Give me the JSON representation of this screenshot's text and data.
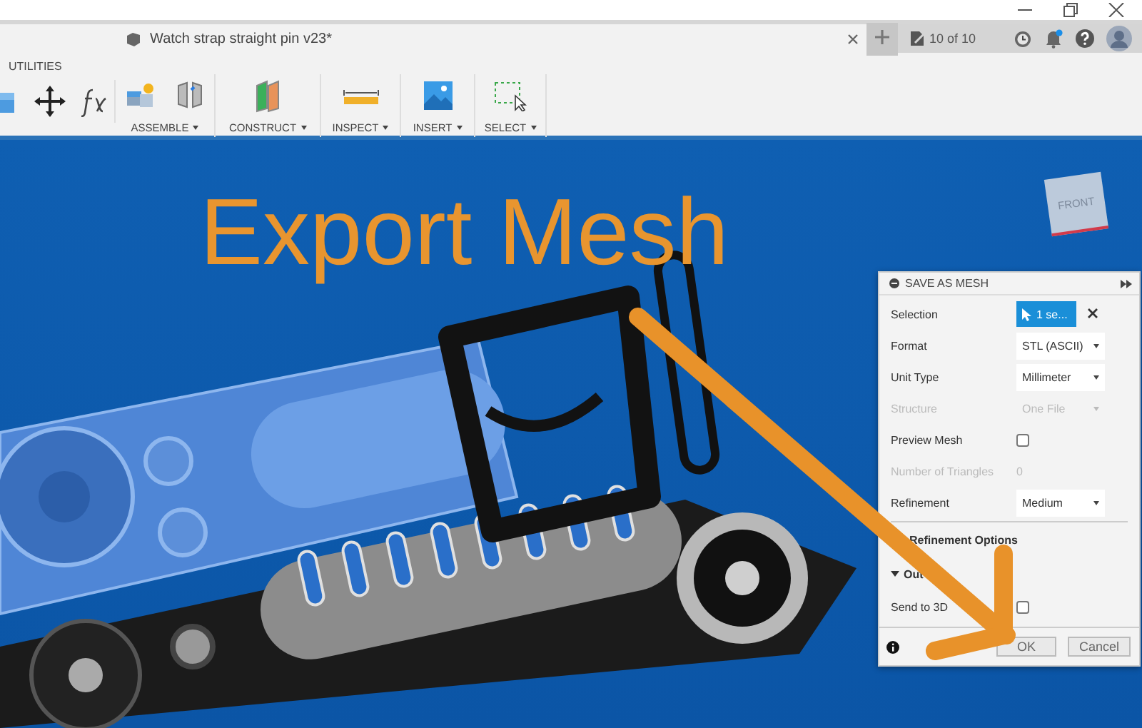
{
  "document_tab": {
    "title": "Watch strap straight pin v23*"
  },
  "tab_bar": {
    "counter": "10 of 10"
  },
  "toolbar": {
    "active_tab": "UTILITIES",
    "groups": [
      {
        "label": "ASSEMBLE"
      },
      {
        "label": "CONSTRUCT"
      },
      {
        "label": "INSPECT"
      },
      {
        "label": "INSERT"
      },
      {
        "label": "SELECT"
      }
    ]
  },
  "viewport": {
    "overlay_title": "Export Mesh",
    "view_cube": {
      "label": "FRONT"
    }
  },
  "dialog": {
    "title": "SAVE AS MESH",
    "rows": [
      {
        "kind": "selection",
        "label": "Selection",
        "value": "1 se..."
      },
      {
        "kind": "dropdown",
        "label": "Format",
        "value": "STL (ASCII)",
        "disabled": false
      },
      {
        "kind": "dropdown",
        "label": "Unit Type",
        "value": "Millimeter",
        "disabled": false
      },
      {
        "kind": "dropdown",
        "label": "Structure",
        "value": "One File",
        "disabled": true
      },
      {
        "kind": "checkbox",
        "label": "Preview Mesh",
        "checked": false,
        "disabled": false
      },
      {
        "kind": "readout",
        "label": "Number of Triangles",
        "value": "0",
        "disabled": true
      },
      {
        "kind": "dropdown",
        "label": "Refinement",
        "value": "Medium",
        "disabled": false
      },
      {
        "kind": "section",
        "label": "Refinement Options"
      },
      {
        "kind": "section",
        "label": "Out",
        "expanded": true
      },
      {
        "kind": "checkbox",
        "label": "Send to 3D",
        "checked": false,
        "disabled": false
      }
    ],
    "buttons": [
      {
        "label": "OK"
      },
      {
        "label": "Cancel"
      }
    ]
  }
}
